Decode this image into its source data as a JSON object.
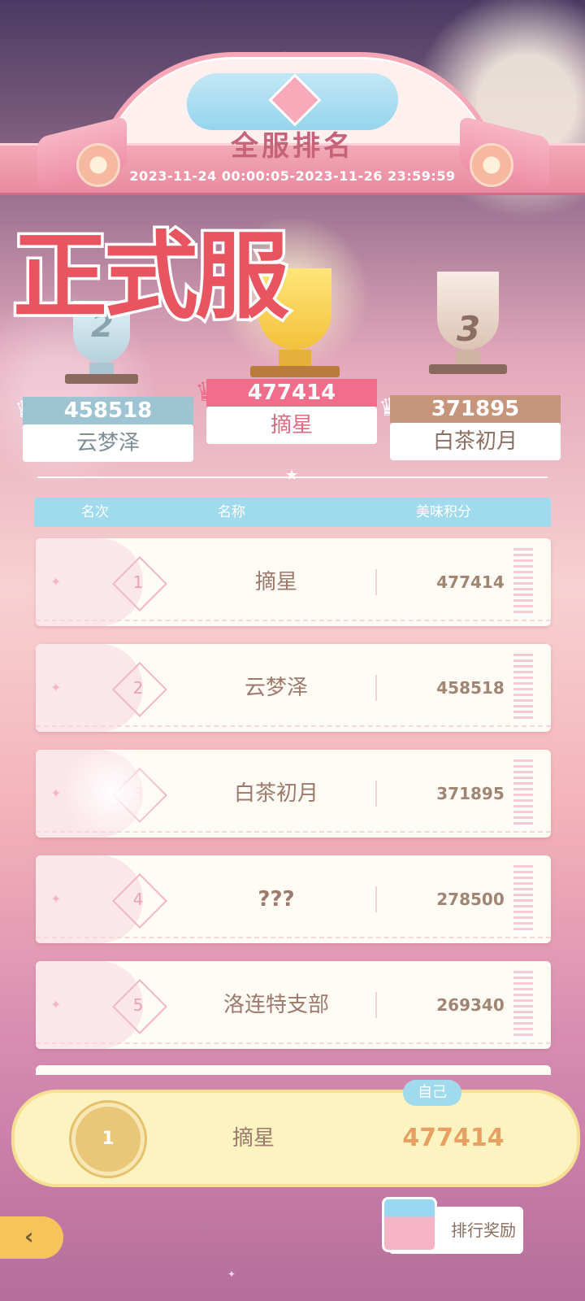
{
  "header": {
    "title": "全服排名",
    "date_range": "2023-11-24 00:00:05-2023-11-26 23:59:59",
    "watermark": "正式服"
  },
  "podium": {
    "first": {
      "rank": "1",
      "score": "477414",
      "name": "摘星",
      "color": "#f06e8c"
    },
    "second": {
      "rank": "2",
      "score": "458518",
      "name": "云梦泽",
      "color": "#9ec3d3"
    },
    "third": {
      "rank": "3",
      "score": "371895",
      "name": "白茶初月",
      "color": "#c6957b"
    }
  },
  "table": {
    "columns": [
      "名次",
      "名称",
      "美味积分"
    ],
    "rows": [
      {
        "rank": "1",
        "name": "摘星",
        "score": "477414"
      },
      {
        "rank": "2",
        "name": "云梦泽",
        "score": "458518"
      },
      {
        "rank": "3",
        "name": "白茶初月",
        "score": "371895"
      },
      {
        "rank": "4",
        "name": "???",
        "score": "278500"
      },
      {
        "rank": "5",
        "name": "洛连特支部",
        "score": "269340"
      }
    ]
  },
  "self": {
    "tag": "自己",
    "rank": "1",
    "name": "摘星",
    "score": "477414"
  },
  "footer": {
    "back_icon": "back-arrow-icon",
    "reward_label": "排行奖励",
    "reward_icon": "gift-box-icon"
  },
  "colors": {
    "accent_blue": "#9fdbec",
    "accent_pink": "#f06e8c",
    "self_score": "#e7a061"
  }
}
